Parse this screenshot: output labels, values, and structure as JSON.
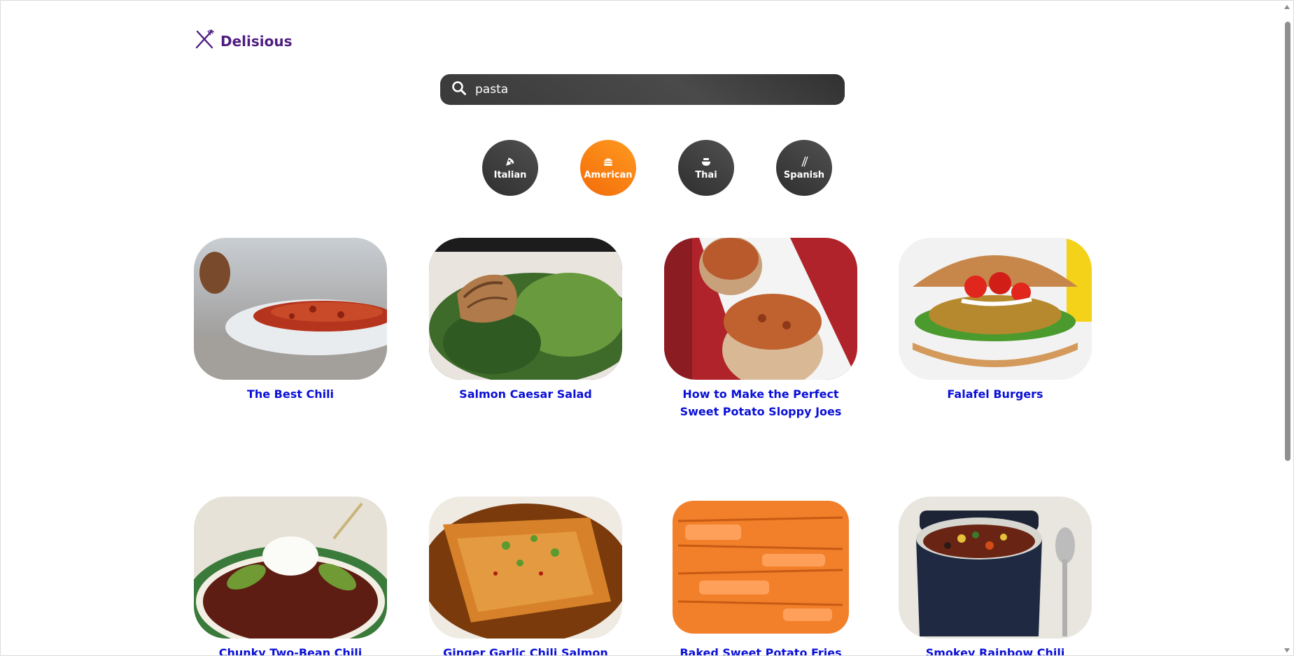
{
  "app": {
    "name": "Delisious",
    "logo_icon": "fork-knife-icon"
  },
  "search": {
    "value": "pasta",
    "icon": "search-icon"
  },
  "categories": [
    {
      "label": "Italian",
      "icon": "pizza-icon",
      "active": false
    },
    {
      "label": "American",
      "icon": "burger-icon",
      "active": true
    },
    {
      "label": "Thai",
      "icon": "noodle-bowl-icon",
      "active": false
    },
    {
      "label": "Spanish",
      "icon": "chopsticks-icon",
      "active": false
    }
  ],
  "recipes": [
    {
      "title": "The Best Chili",
      "image": "chili-bowl"
    },
    {
      "title": "Salmon Caesar Salad",
      "image": "salmon-salad"
    },
    {
      "title": "How to Make the Perfect Sweet Potato Sloppy Joes",
      "image": "stuffed-sweet-potato"
    },
    {
      "title": "Falafel Burgers",
      "image": "falafel-burger"
    },
    {
      "title": "Chunky Two-Bean Chili",
      "image": "bean-chili-avocado"
    },
    {
      "title": "Ginger Garlic Chili Salmon",
      "image": "chili-salmon"
    },
    {
      "title": "Baked Sweet Potato Fries",
      "image": "sweet-potato-fries"
    },
    {
      "title": "Smokey Rainbow Chili",
      "image": "rainbow-chili-pot"
    }
  ],
  "colors": {
    "accent": "#f47b12",
    "brand": "#4f1d80",
    "link": "#0a10d6",
    "dark": "#3c3c3c"
  }
}
